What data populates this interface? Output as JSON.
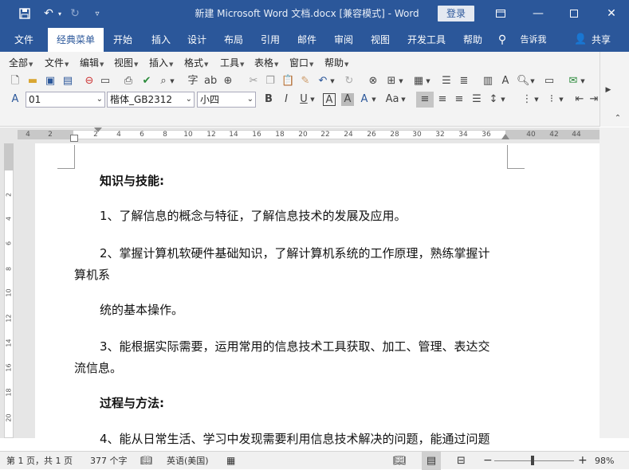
{
  "title_bar": {
    "doc_title": "新建 Microsoft Word 文档.docx [兼容模式] - Word",
    "login_label": "登录"
  },
  "ribbon_tabs": [
    "文件",
    "经典菜单",
    "开始",
    "插入",
    "设计",
    "布局",
    "引用",
    "邮件",
    "审阅",
    "视图",
    "开发工具",
    "帮助"
  ],
  "tell_me": "告诉我",
  "share_label": "共享",
  "classic_menus": [
    "全部",
    "文件",
    "编辑",
    "视图",
    "插入",
    "格式",
    "工具",
    "表格",
    "窗口",
    "帮助"
  ],
  "format_bar": {
    "style_value": "01",
    "font_value": "楷体_GB2312",
    "size_value": "小四"
  },
  "ruler": {
    "h_ticks": [
      "4",
      "2",
      "2",
      "4",
      "6",
      "8",
      "10",
      "12",
      "14",
      "16",
      "18",
      "20",
      "22",
      "24",
      "26",
      "28",
      "30",
      "32",
      "34",
      "36",
      "40",
      "42",
      "44"
    ],
    "v_ticks": [
      "2",
      "4",
      "6",
      "8",
      "10",
      "12",
      "14",
      "16",
      "18",
      "20"
    ]
  },
  "document": {
    "heading1": "知识与技能:",
    "p1": "1、了解信息的概念与特征，了解信息技术的发展及应用。",
    "p2_line1": "2、掌握计算机软硬件基础知识，了解计算机系统的工作原理，熟练掌握计",
    "p2_line2": "算机系",
    "p3": "统的基本操作。",
    "p4_line1": "3、能根据实际需要，运用常用的信息技术工具获取、加工、管理、表达交",
    "p4_line2": "流信息。",
    "heading2": "过程与方法:",
    "p5_partial": "4、能从日常生活、学习中发现需要利用信息技术解决的问题，能通过问题"
  },
  "status_bar": {
    "page_info": "第 1 页，共 1 页",
    "word_count": "377 个字",
    "language": "英语(美国)",
    "zoom": "98%"
  }
}
